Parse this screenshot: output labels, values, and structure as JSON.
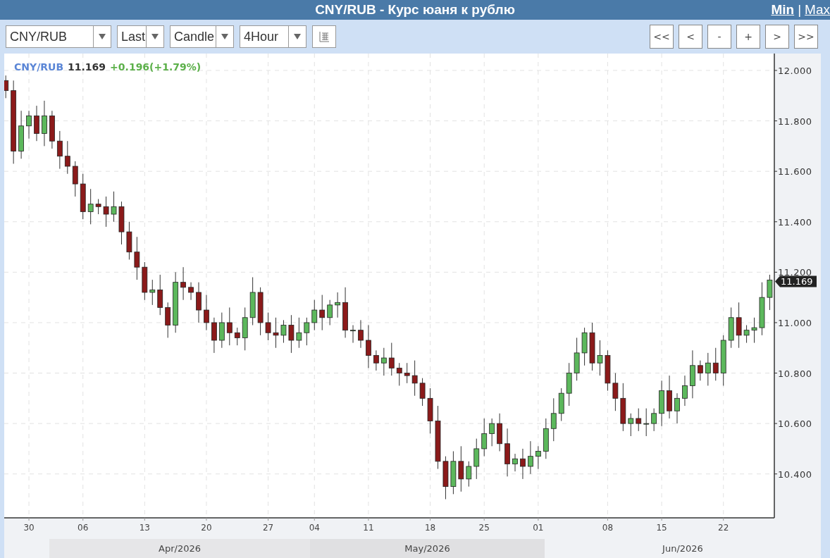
{
  "window": {
    "title": "CNY/RUB - Курс юаня к рублю",
    "links": [
      {
        "label": "Min"
      },
      {
        "label": "Max"
      }
    ],
    "link_separator": "|"
  },
  "toolbar": {
    "selects": [
      {
        "value": "CNY/RUB"
      },
      {
        "value": "Last"
      },
      {
        "value": "Candle"
      },
      {
        "value": "4Hour"
      }
    ],
    "nav_buttons": [
      "<<",
      "<",
      "-",
      "+",
      ">",
      ">>"
    ]
  },
  "legend": {
    "symbol": "CNY/RUB",
    "price": "11.169",
    "change": "+0.196(+1.79%)"
  },
  "price_label": "11.169",
  "chart_data": {
    "type": "candlestick",
    "grid": true,
    "ylim": [
      10.226,
      12.067
    ],
    "yticks": [
      {
        "value": 10.4,
        "label": "10.400"
      },
      {
        "value": 10.6,
        "label": "10.600"
      },
      {
        "value": 10.8,
        "label": "10.800"
      },
      {
        "value": 11.0,
        "label": "11.000"
      },
      {
        "value": 11.2,
        "label": "11.200"
      },
      {
        "value": 11.4,
        "label": "11.400"
      },
      {
        "value": 11.6,
        "label": "11.600"
      },
      {
        "value": 11.8,
        "label": "11.800"
      },
      {
        "value": 12.0,
        "label": "12.000"
      }
    ],
    "categories": [
      null,
      null,
      null,
      "30",
      null,
      null,
      null,
      null,
      null,
      null,
      "06",
      null,
      null,
      null,
      null,
      null,
      null,
      null,
      "13",
      null,
      null,
      null,
      null,
      null,
      null,
      null,
      "20",
      null,
      null,
      null,
      null,
      null,
      null,
      null,
      "27",
      null,
      null,
      null,
      null,
      null,
      "04",
      null,
      null,
      null,
      null,
      null,
      null,
      "11",
      null,
      null,
      null,
      null,
      null,
      null,
      null,
      "18",
      null,
      null,
      null,
      null,
      null,
      null,
      "25",
      null,
      null,
      null,
      null,
      null,
      null,
      "01",
      null,
      null,
      null,
      null,
      null,
      null,
      null,
      null,
      "08",
      null,
      null,
      null,
      null,
      null,
      null,
      "15",
      null,
      null,
      null,
      null,
      null,
      null,
      null,
      "22",
      null,
      null,
      null,
      null,
      null,
      null
    ],
    "ohlc": [
      [
        11.96,
        11.98,
        11.89,
        11.92
      ],
      [
        11.92,
        11.96,
        11.63,
        11.68
      ],
      [
        11.68,
        11.84,
        11.65,
        11.78
      ],
      [
        11.78,
        11.84,
        11.73,
        11.82
      ],
      [
        11.82,
        11.86,
        11.72,
        11.75
      ],
      [
        11.75,
        11.88,
        11.7,
        11.82
      ],
      [
        11.82,
        11.84,
        11.69,
        11.72
      ],
      [
        11.72,
        11.76,
        11.61,
        11.66
      ],
      [
        11.66,
        11.72,
        11.59,
        11.62
      ],
      [
        11.62,
        11.64,
        11.5,
        11.55
      ],
      [
        11.55,
        11.59,
        11.41,
        11.44
      ],
      [
        11.44,
        11.53,
        11.39,
        11.47
      ],
      [
        11.47,
        11.49,
        11.43,
        11.46
      ],
      [
        11.46,
        11.5,
        11.38,
        11.43
      ],
      [
        11.43,
        11.52,
        11.4,
        11.46
      ],
      [
        11.46,
        11.48,
        11.31,
        11.36
      ],
      [
        11.36,
        11.4,
        11.25,
        11.28
      ],
      [
        11.28,
        11.34,
        11.17,
        11.22
      ],
      [
        11.22,
        11.24,
        11.09,
        11.12
      ],
      [
        11.12,
        11.17,
        11.07,
        11.13
      ],
      [
        11.13,
        11.19,
        11.03,
        11.06
      ],
      [
        11.06,
        11.08,
        10.94,
        10.99
      ],
      [
        10.99,
        11.2,
        10.96,
        11.16
      ],
      [
        11.16,
        11.22,
        11.09,
        11.14
      ],
      [
        11.14,
        11.16,
        11.09,
        11.12
      ],
      [
        11.12,
        11.16,
        11.0,
        11.05
      ],
      [
        11.05,
        11.11,
        10.97,
        11.0
      ],
      [
        11.0,
        11.02,
        10.88,
        10.93
      ],
      [
        10.93,
        11.04,
        10.9,
        11.0
      ],
      [
        11.0,
        11.06,
        10.91,
        10.96
      ],
      [
        10.96,
        10.98,
        10.91,
        10.94
      ],
      [
        10.94,
        11.06,
        10.89,
        11.02
      ],
      [
        11.02,
        11.18,
        10.99,
        11.12
      ],
      [
        11.12,
        11.14,
        10.95,
        11.0
      ],
      [
        11.0,
        11.04,
        10.93,
        10.96
      ],
      [
        10.96,
        11.02,
        10.9,
        10.95
      ],
      [
        10.95,
        11.01,
        10.92,
        10.99
      ],
      [
        10.99,
        11.03,
        10.88,
        10.93
      ],
      [
        10.93,
        11.02,
        10.9,
        10.96
      ],
      [
        10.96,
        11.02,
        10.91,
        11.0
      ],
      [
        11.0,
        11.09,
        10.97,
        11.05
      ],
      [
        11.05,
        11.11,
        10.97,
        11.02
      ],
      [
        11.02,
        11.09,
        10.99,
        11.07
      ],
      [
        11.07,
        11.12,
        11.02,
        11.08
      ],
      [
        11.08,
        11.14,
        10.94,
        10.97
      ],
      [
        10.97,
        10.99,
        10.92,
        10.97
      ],
      [
        10.97,
        11.01,
        10.9,
        10.93
      ],
      [
        10.93,
        10.99,
        10.82,
        10.87
      ],
      [
        10.87,
        10.89,
        10.81,
        10.84
      ],
      [
        10.84,
        10.9,
        10.79,
        10.86
      ],
      [
        10.86,
        10.92,
        10.79,
        10.82
      ],
      [
        10.82,
        10.84,
        10.75,
        10.8
      ],
      [
        10.8,
        10.84,
        10.76,
        10.79
      ],
      [
        10.79,
        10.85,
        10.71,
        10.76
      ],
      [
        10.76,
        10.78,
        10.67,
        10.7
      ],
      [
        10.7,
        10.74,
        10.56,
        10.61
      ],
      [
        10.61,
        10.67,
        10.42,
        10.45
      ],
      [
        10.45,
        10.47,
        10.3,
        10.35
      ],
      [
        10.35,
        10.49,
        10.32,
        10.45
      ],
      [
        10.45,
        10.51,
        10.33,
        10.38
      ],
      [
        10.38,
        10.45,
        10.35,
        10.43
      ],
      [
        10.43,
        10.54,
        10.38,
        10.5
      ],
      [
        10.5,
        10.62,
        10.47,
        10.56
      ],
      [
        10.56,
        10.62,
        10.51,
        10.6
      ],
      [
        10.6,
        10.64,
        10.49,
        10.52
      ],
      [
        10.52,
        10.58,
        10.39,
        10.44
      ],
      [
        10.44,
        10.48,
        10.41,
        10.46
      ],
      [
        10.46,
        10.5,
        10.38,
        10.43
      ],
      [
        10.43,
        10.53,
        10.4,
        10.47
      ],
      [
        10.47,
        10.51,
        10.42,
        10.49
      ],
      [
        10.49,
        10.62,
        10.46,
        10.58
      ],
      [
        10.58,
        10.7,
        10.53,
        10.64
      ],
      [
        10.64,
        10.74,
        10.61,
        10.72
      ],
      [
        10.72,
        10.84,
        10.67,
        10.8
      ],
      [
        10.8,
        10.94,
        10.77,
        10.88
      ],
      [
        10.88,
        10.98,
        10.83,
        10.96
      ],
      [
        10.96,
        11.0,
        10.81,
        10.84
      ],
      [
        10.84,
        10.93,
        10.79,
        10.87
      ],
      [
        10.87,
        10.89,
        10.73,
        10.76
      ],
      [
        10.76,
        10.8,
        10.65,
        10.7
      ],
      [
        10.7,
        10.76,
        10.57,
        10.6
      ],
      [
        10.6,
        10.64,
        10.55,
        10.62
      ],
      [
        10.62,
        10.66,
        10.57,
        10.6
      ],
      [
        10.6,
        10.66,
        10.55,
        10.6
      ],
      [
        10.6,
        10.66,
        10.57,
        10.64
      ],
      [
        10.64,
        10.77,
        10.59,
        10.73
      ],
      [
        10.73,
        10.79,
        10.62,
        10.65
      ],
      [
        10.65,
        10.72,
        10.6,
        10.7
      ],
      [
        10.7,
        10.79,
        10.67,
        10.75
      ],
      [
        10.75,
        10.89,
        10.7,
        10.83
      ],
      [
        10.83,
        10.85,
        10.77,
        10.8
      ],
      [
        10.8,
        10.88,
        10.75,
        10.84
      ],
      [
        10.84,
        10.9,
        10.77,
        10.8
      ],
      [
        10.8,
        10.95,
        10.75,
        10.93
      ],
      [
        10.93,
        11.06,
        10.9,
        11.02
      ],
      [
        11.02,
        11.08,
        10.9,
        10.95
      ],
      [
        10.95,
        10.99,
        10.92,
        10.97
      ],
      [
        10.97,
        11.02,
        10.92,
        10.98
      ],
      [
        10.98,
        11.16,
        10.95,
        11.1
      ],
      [
        11.1,
        11.19,
        11.05,
        11.169
      ]
    ]
  },
  "months": [
    "Apr/2026",
    "May/2026",
    "Jun/2026"
  ]
}
